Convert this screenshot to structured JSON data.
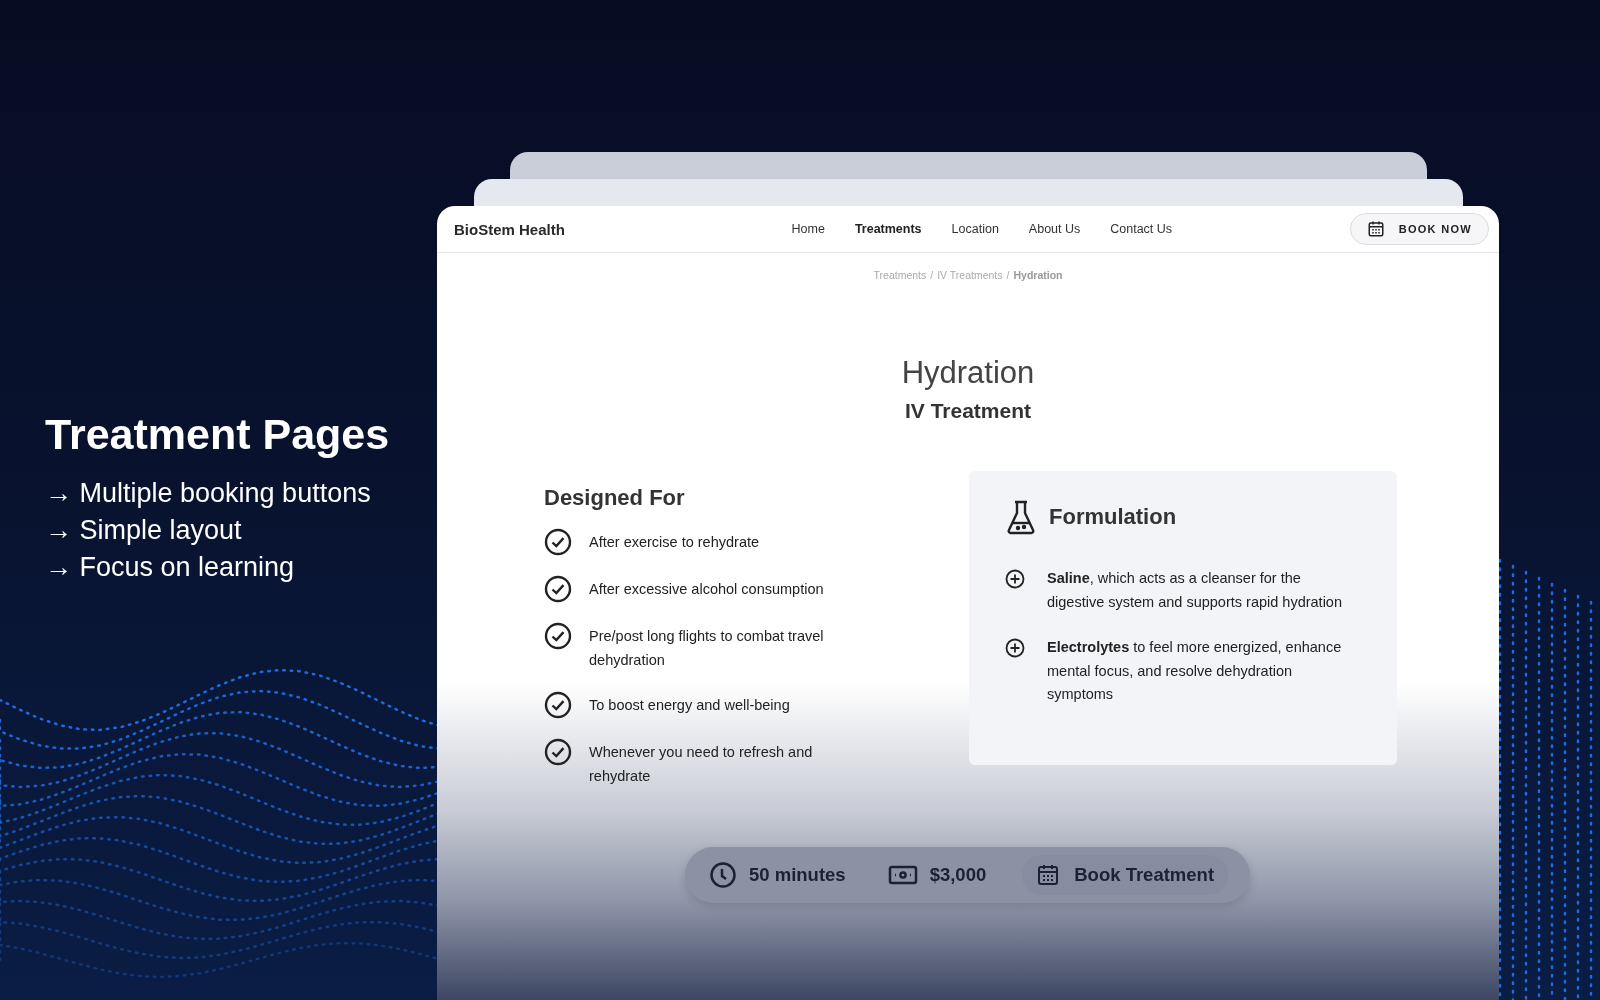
{
  "promo": {
    "title": "Treatment Pages",
    "points": [
      "→ Multiple booking buttons",
      "→ Simple layout",
      "→ Focus on learning"
    ]
  },
  "site": {
    "brand": "BioStem Health",
    "nav": [
      {
        "label": "Home",
        "selected": false
      },
      {
        "label": "Treatments",
        "selected": true
      },
      {
        "label": "Location",
        "selected": false
      },
      {
        "label": "About Us",
        "selected": false
      },
      {
        "label": "Contact Us",
        "selected": false
      }
    ],
    "book_button": "BOOK NOW",
    "breadcrumb": [
      {
        "label": "Treatments",
        "selected": false
      },
      {
        "label": "IV Treatments",
        "selected": false
      },
      {
        "label": "Hydration",
        "selected": true
      }
    ],
    "breadcrumb_separator": "/",
    "title": "Hydration",
    "subtitle": "IV Treatment",
    "designed_for": {
      "heading": "Designed For",
      "items": [
        "After exercise to rehydrate",
        "After excessive alcohol consumption",
        "Pre/post long flights to combat travel dehydration",
        "To boost energy and well-being",
        "Whenever you need to refresh and rehydrate"
      ]
    },
    "formulation": {
      "heading": "Formulation",
      "items": [
        "**Saline**, which acts as a cleanser for the digestive system and supports rapid hydration",
        "**Electrolytes** to feel more energized, enhance mental focus, and resolve dehydration symptoms"
      ]
    },
    "summary_bar": {
      "duration": "50 minutes",
      "price": "$3,000",
      "book_button": "Book Treatment"
    }
  }
}
